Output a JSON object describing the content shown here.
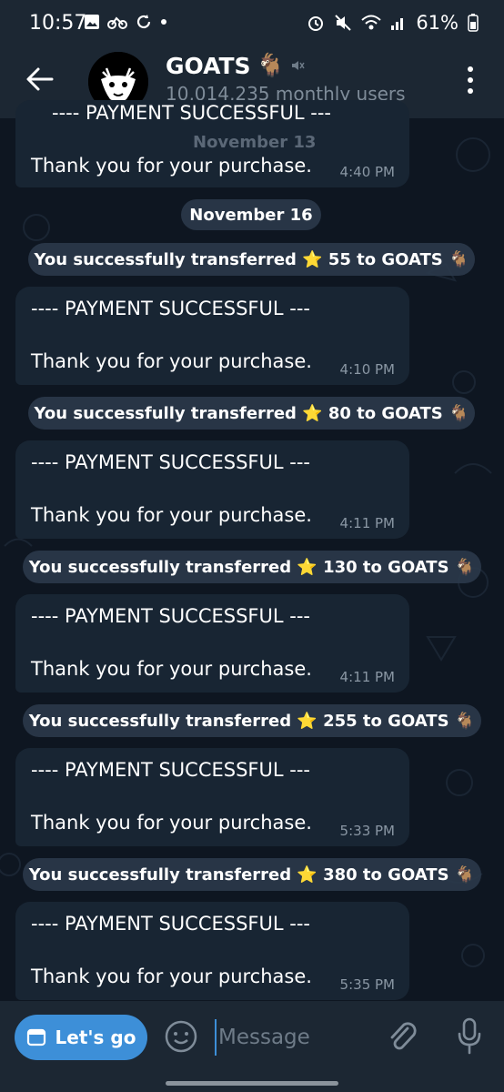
{
  "status_bar": {
    "time": "10:57",
    "battery": "61%"
  },
  "header": {
    "title": "GOATS",
    "title_emoji": "🐐",
    "subtitle": "10,014,235 monthly users"
  },
  "messages": {
    "cut_top": {
      "heading": "---- PAYMENT SUCCESSFUL ---",
      "date_overlay": "November 13",
      "body": "Thank you for your purchase.",
      "time": "4:40 PM"
    },
    "date_separator": "November 16",
    "items": [
      {
        "service": "You successfully transferred ⭐ 55 to GOATS 🐐",
        "heading": "---- PAYMENT SUCCESSFUL ---",
        "body": "Thank you for your purchase.",
        "time": "4:10 PM"
      },
      {
        "service": "You successfully transferred ⭐ 80 to GOATS 🐐",
        "heading": "---- PAYMENT SUCCESSFUL ---",
        "body": "Thank you for your purchase.",
        "time": "4:11 PM"
      },
      {
        "service": "You successfully transferred ⭐ 130 to GOATS 🐐",
        "heading": "---- PAYMENT SUCCESSFUL ---",
        "body": "Thank you for your purchase.",
        "time": "4:11 PM"
      },
      {
        "service": "You successfully transferred ⭐ 255 to GOATS 🐐",
        "heading": "---- PAYMENT SUCCESSFUL ---",
        "body": "Thank you for your purchase.",
        "time": "5:33 PM"
      },
      {
        "service": "You successfully transferred ⭐ 380 to GOATS 🐐",
        "heading": "---- PAYMENT SUCCESSFUL ---",
        "body": "Thank you for your purchase.",
        "time": "5:35 PM"
      }
    ]
  },
  "input_bar": {
    "bot_button_label": "Let's go",
    "message_placeholder": "Message"
  },
  "colors": {
    "background": "#0e1621",
    "bar": "#1c2733",
    "bubble": "#182533",
    "accent": "#3d8fd8"
  }
}
